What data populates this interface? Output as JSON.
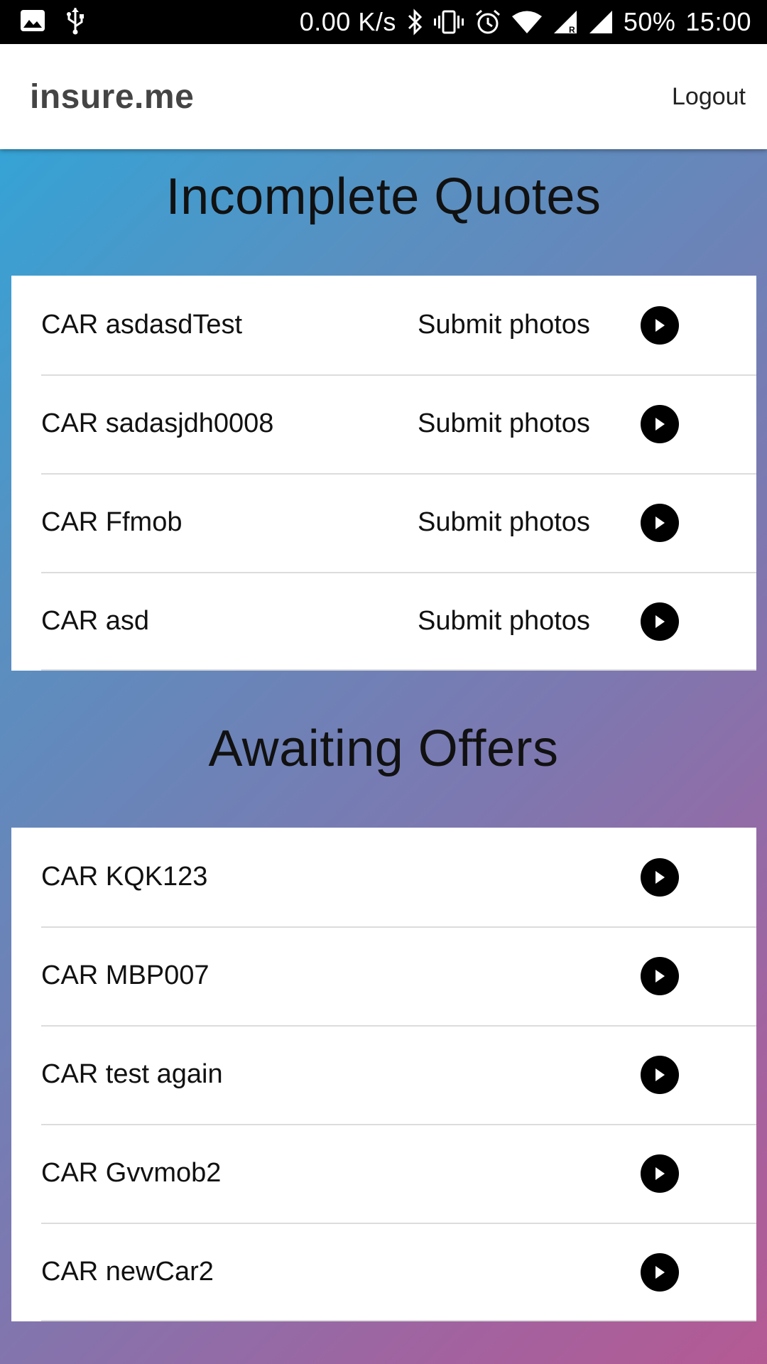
{
  "status_bar": {
    "speed": "0.00 K/s",
    "battery": "50%",
    "time": "15:00",
    "icons": [
      "image-icon",
      "usb-icon",
      "bluetooth-icon",
      "vibrate-icon",
      "alarm-icon",
      "wifi-icon",
      "signal-r-icon",
      "signal-icon"
    ]
  },
  "header": {
    "brand": "insure.me",
    "logout_label": "Logout"
  },
  "incomplete": {
    "title": "Incomplete Quotes",
    "items": [
      {
        "label": "CAR asdasdTest",
        "action": "Submit photos"
      },
      {
        "label": "CAR sadasjdh0008",
        "action": "Submit photos"
      },
      {
        "label": "CAR Ffmob",
        "action": "Submit photos"
      },
      {
        "label": "CAR asd",
        "action": "Submit photos"
      }
    ]
  },
  "awaiting": {
    "title": "Awaiting Offers",
    "items": [
      {
        "label": "CAR KQK123"
      },
      {
        "label": "CAR MBP007"
      },
      {
        "label": "CAR test again"
      },
      {
        "label": "CAR Gvvmob2"
      },
      {
        "label": "CAR newCar2"
      }
    ]
  },
  "colors": {
    "gradient_start": "#2aa9dc",
    "gradient_end": "#b45a93",
    "icon_fill": "#000000"
  }
}
